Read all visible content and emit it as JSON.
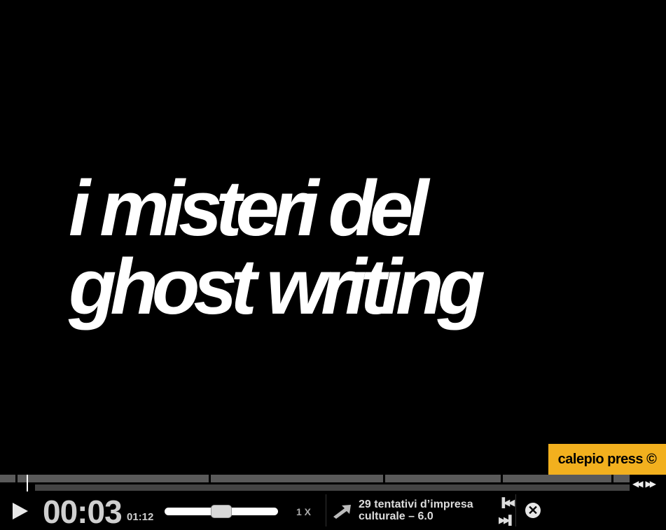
{
  "video": {
    "title_line1": "i misteri del",
    "title_line2": "ghost writing"
  },
  "brand": {
    "label": "calepio press ©",
    "color": "#f2b01e"
  },
  "player": {
    "elapsed": "00:03",
    "duration": "01:12",
    "progress_fraction": 0.042,
    "volume_fraction": 0.5,
    "speed_label": "1 X",
    "next_title": "29 tentativi d’impresa culturale – 6.0",
    "icons": {
      "play": "play-icon",
      "next": "arrow-next-icon",
      "skip_back": "skip-back-icon",
      "skip_forward": "skip-forward-icon",
      "close": "close-icon",
      "chapter_prev": "chapter-prev-icon",
      "chapter_next": "chapter-next-icon"
    }
  }
}
